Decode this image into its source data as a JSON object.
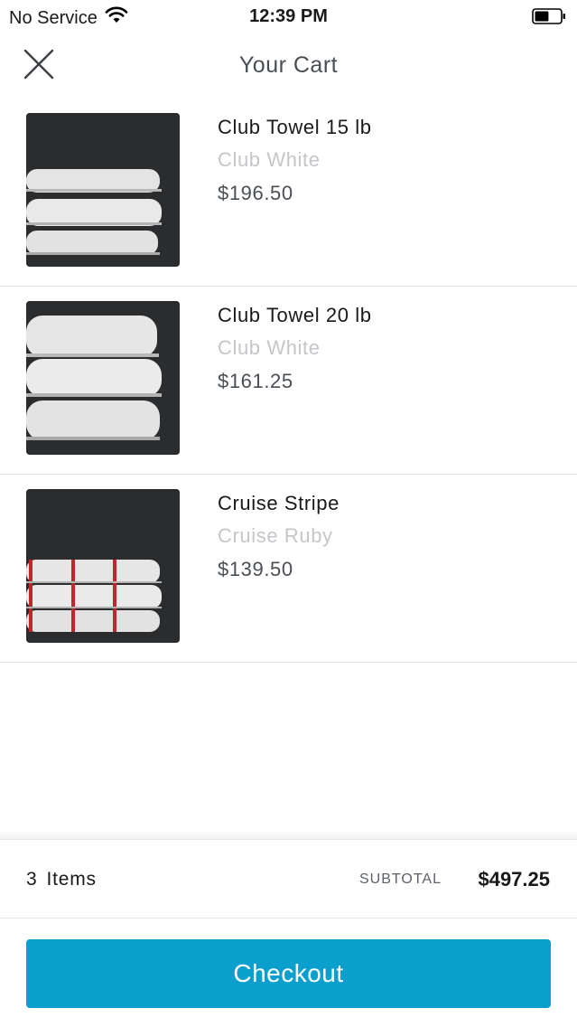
{
  "status_bar": {
    "carrier": "No Service",
    "time": "12:39 PM",
    "wifi_icon": "wifi-icon",
    "battery_icon": "battery-icon",
    "battery_level": 0.55
  },
  "nav": {
    "title": "Your Cart",
    "close_icon": "close-icon"
  },
  "cart": {
    "items": [
      {
        "name": "Club Towel 15 lb",
        "variant": "Club White",
        "price": "$196.50",
        "image": "white-towel-stack"
      },
      {
        "name": "Club Towel 20 lb",
        "variant": "Club White",
        "price": "$161.25",
        "image": "white-towel-stack"
      },
      {
        "name": "Cruise Stripe",
        "variant": "Cruise Ruby",
        "price": "$139.50",
        "image": "red-stripe-towel-stack"
      }
    ]
  },
  "summary": {
    "count": "3",
    "count_label": "Items",
    "subtotal_label": "SUBTOTAL",
    "subtotal_value": "$497.25"
  },
  "checkout": {
    "label": "Checkout"
  },
  "colors": {
    "accent": "#0b9fcd",
    "variant_text": "#c4c6c9",
    "stripe_red": "#c0272d"
  }
}
